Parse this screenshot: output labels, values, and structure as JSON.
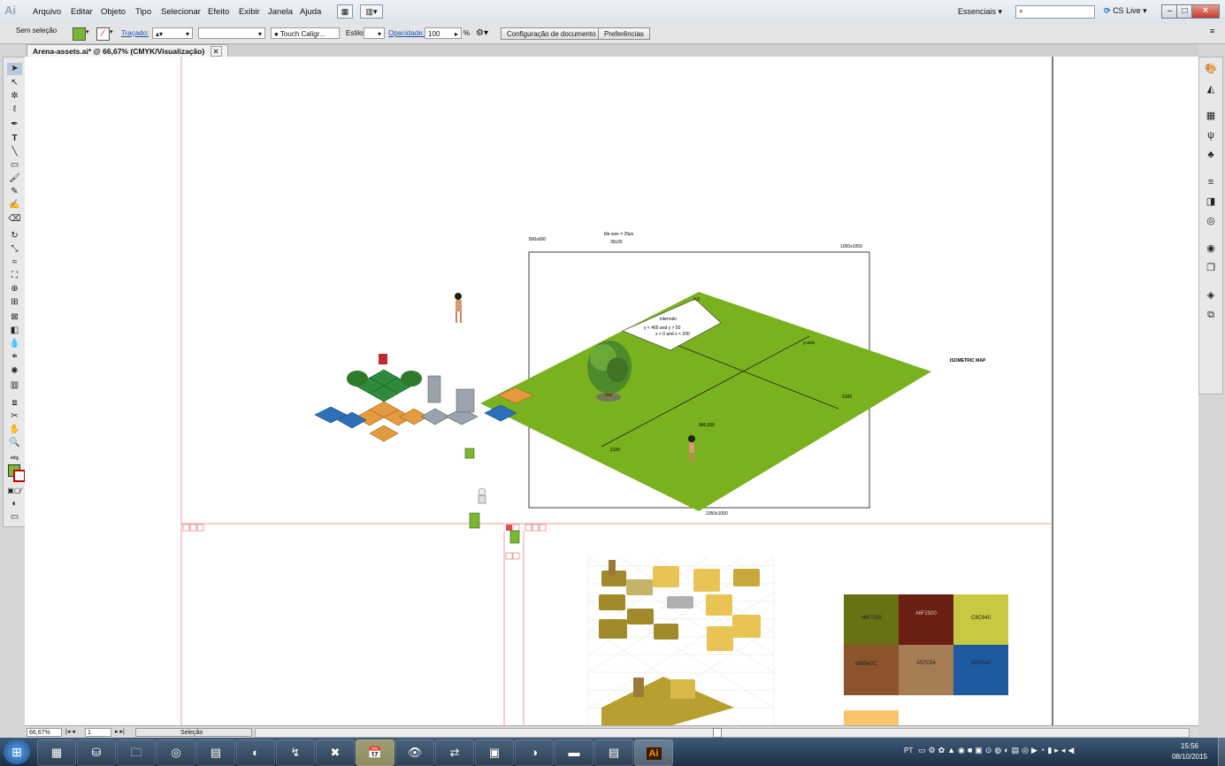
{
  "app": {
    "logo_text": "Ai",
    "menu": [
      "Arquivo",
      "Editar",
      "Objeto",
      "Tipo",
      "Selecionar",
      "Efeito",
      "Exibir",
      "Janela",
      "Ajuda"
    ],
    "workspace": "Essenciais",
    "cs_live": "CS Live",
    "window_buttons": [
      "–",
      "□",
      "✕"
    ]
  },
  "control_bar": {
    "selection": "Sem seleção",
    "stroke_label": "Traçado:",
    "brush": "Touch Caligr...",
    "style_label": "Estilo:",
    "opacity_label": "Opacidade:",
    "opacity_value": "100",
    "opacity_unit": "%",
    "doc_setup_button": "Configuração de documento",
    "prefs_button": "Preferências"
  },
  "document": {
    "tab_title": "Arena-assets.ai* @ 66,67% (CMYK/Visualização)"
  },
  "canvas": {
    "label_800x600": "800x600",
    "tile_size": "tile-size = 35px",
    "tile_dims": "30x35",
    "label_1050_top": "1050x1050",
    "label_1050_bottom": "1050x1050",
    "origin": "0,0",
    "interval_title": "intervalo",
    "interval_line1": "y < 400 and y > 50",
    "interval_line2": "x > 0  and  x < 200",
    "yaxis": "y-axis",
    "label_2100_right": "2100",
    "label_2100_left": "2100",
    "center": "966,006",
    "iso_map": "ISOMETRIC MAP"
  },
  "palette": [
    {
      "hex": "#687215",
      "color": "#687215"
    },
    {
      "hex": "#6F2500",
      "color": "#6B1E12"
    },
    {
      "hex": "C8C940",
      "color": "#C8C940"
    },
    {
      "hex": "#8B542C",
      "color": "#8B542C"
    },
    {
      "hex": "A57C54",
      "color": "#A57C54"
    },
    {
      "hex": "1D5AA0",
      "color": "#1D5AA0"
    },
    {
      "hex": "",
      "color": "#F9C46A"
    }
  ],
  "status": {
    "zoom": "66,67%",
    "page": "1",
    "tool": "Seleção"
  },
  "taskbar": {
    "lang": "PT",
    "time": "15:56",
    "date": "08/10/2015"
  }
}
